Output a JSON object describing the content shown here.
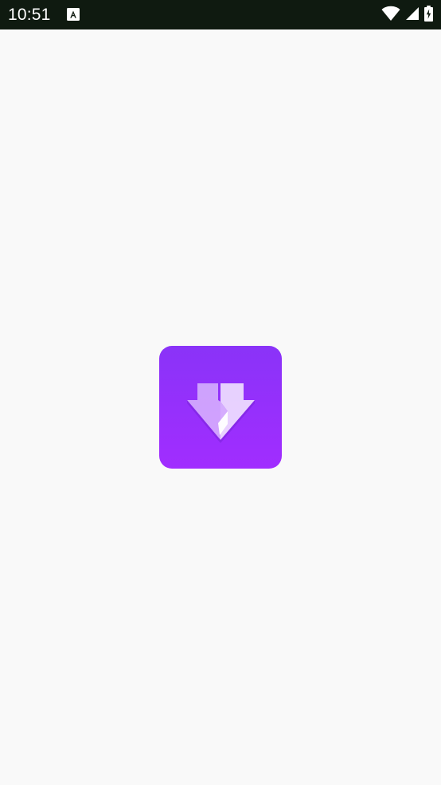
{
  "status_bar": {
    "time": "10:51",
    "notification_icon": "app-notification-icon",
    "wifi_icon": "wifi-icon",
    "signal_icon": "cell-signal-icon",
    "battery_icon": "battery-charging-icon",
    "background_color": "#0f1a10"
  },
  "splash": {
    "logo_icon": "download-arrow-icon",
    "logo_color_top": "#8a33f8",
    "logo_color_bottom": "#a12dff",
    "background_color": "#f9f9f9"
  }
}
